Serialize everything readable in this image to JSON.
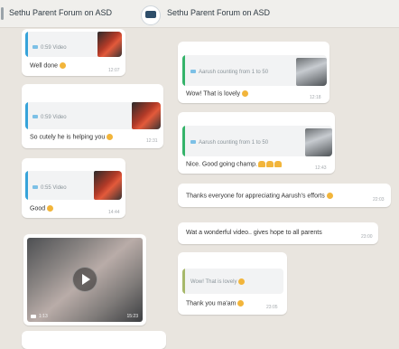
{
  "header": {
    "title_left": "Sethu Parent Forum on ASD",
    "title_right": "Sethu Parent Forum on ASD",
    "avatar_label": "SETHU"
  },
  "messages": [
    {
      "quote": "0:59 Video",
      "text": "Well done",
      "time": "12:07"
    },
    {
      "quote": "Aarush counting from 1 to 50",
      "text": "Wow! That is lovely",
      "time": "12:18"
    },
    {
      "quote": "0:59 Video",
      "text": "So cutely he is helping you",
      "time": "12:31"
    },
    {
      "quote": "Aarush counting from 1 to 50",
      "text": "Nice. Good going champ.",
      "time": "12:43"
    },
    {
      "quote": "0:55 Video",
      "text": "Good",
      "time": "14:44"
    },
    {
      "text": "Thanks everyone for appreciating Aarush's efforts",
      "time": "22:03"
    },
    {
      "text": "Wat a wonderful video.. gives hope to all parents",
      "time": "23:00"
    },
    {
      "duration": "1:13",
      "time": "15:23"
    },
    {
      "quote": "Wow! That is lovely",
      "text": "Thank you ma'am",
      "time": "23:05"
    }
  ],
  "colors": {
    "reply_bar_blue": "#36a3d9",
    "reply_bar_green": "#35b36a",
    "reply_bar_olive": "#a7b86a"
  },
  "icons": [
    "video-camera-icon",
    "play-icon",
    "smile-emoji-icon",
    "clap-emoji-icon",
    "thumbs-up-icon",
    "folded-hands-icon"
  ]
}
